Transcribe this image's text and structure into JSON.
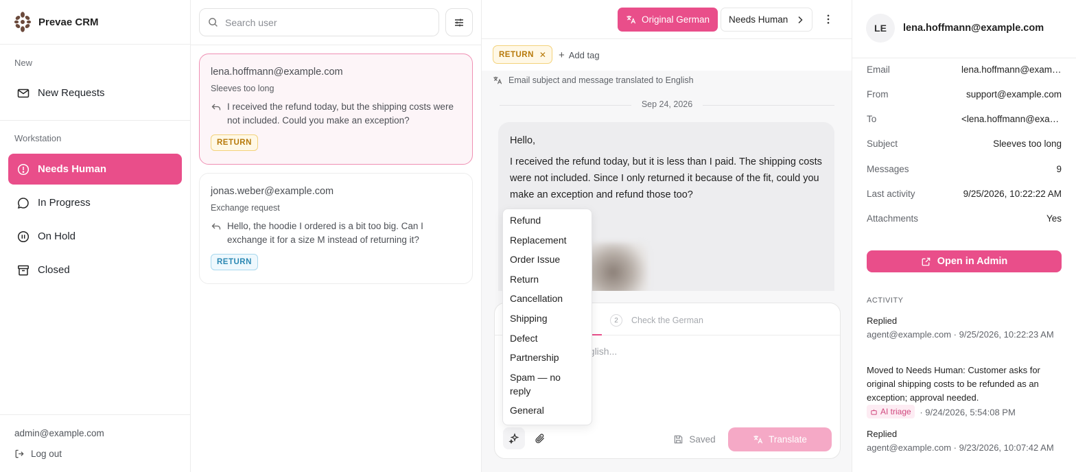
{
  "app": {
    "name": "Prevae CRM"
  },
  "sidebar": {
    "sections": {
      "new": "New",
      "workstation": "Workstation"
    },
    "new_items": [
      {
        "label": "New Requests",
        "icon": "mail-icon"
      }
    ],
    "items": [
      {
        "label": "Needs Human",
        "icon": "alert-circle-icon",
        "active": true
      },
      {
        "label": "In Progress",
        "icon": "chat-bubble-icon"
      },
      {
        "label": "On Hold",
        "icon": "pause-circle-icon"
      },
      {
        "label": "Closed",
        "icon": "archive-box-icon"
      }
    ],
    "footer": {
      "user_email": "admin@example.com",
      "logout_label": "Log out"
    }
  },
  "list": {
    "search_placeholder": "Search user",
    "tickets": [
      {
        "email": "lena.hoffmann@example.com",
        "subject": "Sleeves too long",
        "preview": "I received the refund today, but the shipping costs were not included. Could you make an exception?",
        "tag": "RETURN",
        "selected": true
      },
      {
        "email": "jonas.weber@example.com",
        "subject": "Exchange request",
        "preview": "Hello, the hoodie I ordered is a bit too big. Can I exchange it for a size M instead of returning it?",
        "tag": "RETURN",
        "selected": false
      }
    ]
  },
  "conversation": {
    "toolbar": {
      "original_label": "Original German",
      "status_label": "Needs Human"
    },
    "tags": [
      "RETURN"
    ],
    "add_tag_label": "Add tag",
    "translated_note": "Email subject and message translated to English",
    "date": "Sep 24, 2026",
    "message": {
      "greeting": "Hello,",
      "body": "I received the refund today, but it is less than I paid. The shipping costs were not included. Since I only returned it because of the fit, could you make an exception and refund those too?"
    },
    "composer": {
      "step2_num": "2",
      "step2_label": "Check the German",
      "placeholder_fragment": "nglish...",
      "saved_label": "Saved",
      "translate_label": "Translate"
    },
    "category_dropdown": {
      "options": [
        "Refund",
        "Replacement",
        "Order Issue",
        "Return",
        "Cancellation",
        "Shipping",
        "Defect",
        "Partnership",
        "Spam — no reply",
        "General"
      ]
    }
  },
  "details": {
    "avatar_initials": "LE",
    "header_email": "lena.hoffmann@example.com",
    "fields": [
      {
        "key": "Email",
        "value": "lena.hoffmann@example.com"
      },
      {
        "key": "From",
        "value": "support@example.com"
      },
      {
        "key": "To",
        "value": "<lena.hoffmann@example.com>"
      },
      {
        "key": "Subject",
        "value": "Sleeves too long"
      },
      {
        "key": "Messages",
        "value": "9"
      },
      {
        "key": "Last activity",
        "value": "9/25/2026, 10:22:22 AM"
      },
      {
        "key": "Attachments",
        "value": "Yes"
      }
    ],
    "open_admin_label": "Open in Admin",
    "activity_heading": "ACTIVITY",
    "activity": [
      {
        "title": "Replied",
        "meta": "agent@example.com · 9/25/2026, 10:22:23 AM"
      },
      {
        "title": "Moved to Needs Human: Customer asks for original shipping costs to be refunded as an exception; approval needed.",
        "badge": "AI triage",
        "meta": "· 9/24/2026, 5:54:08 PM"
      },
      {
        "title": "Replied",
        "meta": "agent@example.com · 9/23/2026, 10:07:42 AM"
      }
    ]
  },
  "colors": {
    "accent": "#e94e8a",
    "accent_light": "#f5a9c6",
    "tag_amber": "#b7790a",
    "tag_blue": "#2b88b3"
  }
}
